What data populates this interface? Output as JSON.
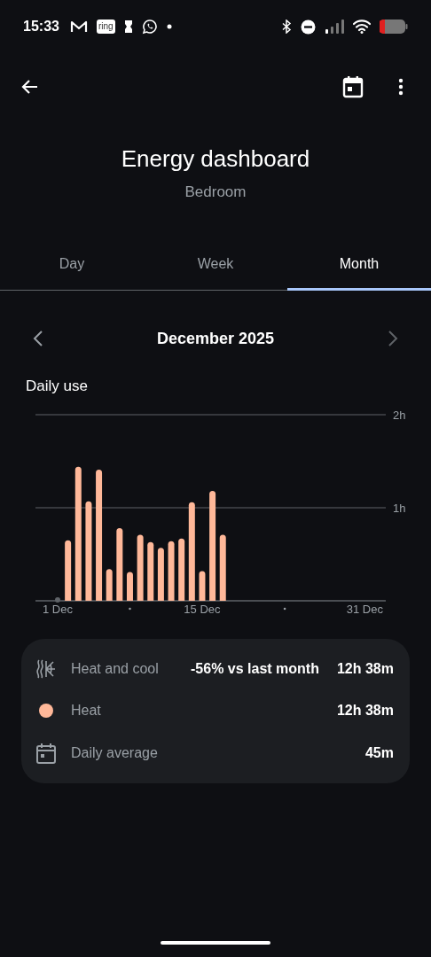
{
  "status_bar": {
    "time": "15:33",
    "notification_logo": "ring"
  },
  "header": {
    "title": "Energy dashboard",
    "subtitle": "Bedroom"
  },
  "tabs": [
    {
      "label": "Day",
      "selected": false
    },
    {
      "label": "Week",
      "selected": false
    },
    {
      "label": "Month",
      "selected": true
    }
  ],
  "period": {
    "label": "December 2025"
  },
  "daily_use": {
    "title": "Daily use",
    "chart_data": {
      "type": "bar",
      "categories": [
        "1 Dec",
        null,
        null,
        null,
        null,
        null,
        null,
        null,
        null,
        null,
        null,
        null,
        null,
        null,
        "15 Dec",
        null,
        null,
        null,
        null,
        null,
        null,
        null,
        null,
        null,
        null,
        null,
        null,
        null,
        null,
        null,
        "31 Dec"
      ],
      "series": [
        {
          "color": "#ffb899",
          "values": [
            0,
            0.65,
            1.44,
            1.07,
            1.41,
            0.34,
            0.78,
            0.31,
            0.71,
            0.63,
            0.57,
            0.64,
            0.67,
            1.06,
            0.32,
            1.18,
            0.71,
            null,
            null,
            null,
            null,
            null,
            null,
            null,
            null,
            null,
            null,
            null,
            null,
            null,
            null
          ]
        }
      ],
      "ylim": [
        0,
        2
      ],
      "yticks": [
        {
          "value": 1,
          "label": "1h"
        },
        {
          "value": 2,
          "label": "2h"
        }
      ]
    }
  },
  "summary": [
    {
      "kind": "total",
      "label": "Heat and cool",
      "comparison": "-56% vs last month",
      "value": "12h 38m"
    },
    {
      "kind": "series",
      "label": "Heat",
      "color": "#ffb899",
      "value": "12h 38m"
    },
    {
      "kind": "average",
      "label": "Daily average",
      "value": "45m"
    }
  ]
}
